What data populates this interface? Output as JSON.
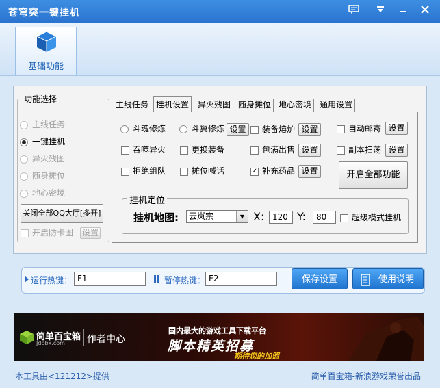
{
  "window": {
    "title": "苍穹突一键挂机"
  },
  "nav": {
    "tab_label": "基础功能"
  },
  "function_select": {
    "title": "功能选择",
    "radios": [
      "主线任务",
      "一键挂机",
      "异火残图",
      "随身摊位",
      "地心密境"
    ],
    "close_button": "关闭全部QQ大厅[多开]",
    "anti_card_check": "开启防卡图",
    "anti_card_settings": "设置"
  },
  "tabs": [
    "主线任务",
    "挂机设置",
    "异火残图",
    "随身摊位",
    "地心密境",
    "通用设置"
  ],
  "hangup": {
    "radio_soul": "斗魂修炼",
    "radio_wing": "斗翼修炼",
    "wing_settings": "设置",
    "check_equip_furnace": "装备熔炉",
    "equip_furnace_settings": "设置",
    "check_auto_mail": "自动邮寄",
    "auto_mail_settings": "设置",
    "check_swallow_fire": "吞噬异火",
    "check_change_equip": "更换装备",
    "check_full_sell": "包满出售",
    "full_sell_settings": "设置",
    "check_dungeon_sweep": "副本扫荡",
    "dungeon_sweep_settings": "设置",
    "check_reject_team": "拒绝组队",
    "check_stall_shout": "摊位喊话",
    "check_refill_potion": "补充药品",
    "refill_potion_settings": "设置",
    "open_all_button": "开启全部功能"
  },
  "locate": {
    "title": "挂机定位",
    "map_label": "挂机地图:",
    "map_value": "云岚宗",
    "x_label": "X:",
    "x_value": "120",
    "y_label": "Y:",
    "y_value": "80",
    "super_mode": "超级模式挂机"
  },
  "hotkeys": {
    "run_label": "运行热键：",
    "run_value": "F1",
    "pause_label": "暂停热键：",
    "pause_value": "F2",
    "save_button": "保存设置",
    "help_button": "使用说明"
  },
  "banner": {
    "brand": "简单百宝箱",
    "brand_url": "Jdbbx.com",
    "author_center": "作者中心",
    "headline_small": "国内最大的游戏工具下载平台",
    "headline_big": "脚本精英招募",
    "headline_sub": "期待您的加盟"
  },
  "footer": {
    "left": "本工具由<121212>提供",
    "right": "简单百宝箱-新浪游戏荣誉出品"
  }
}
